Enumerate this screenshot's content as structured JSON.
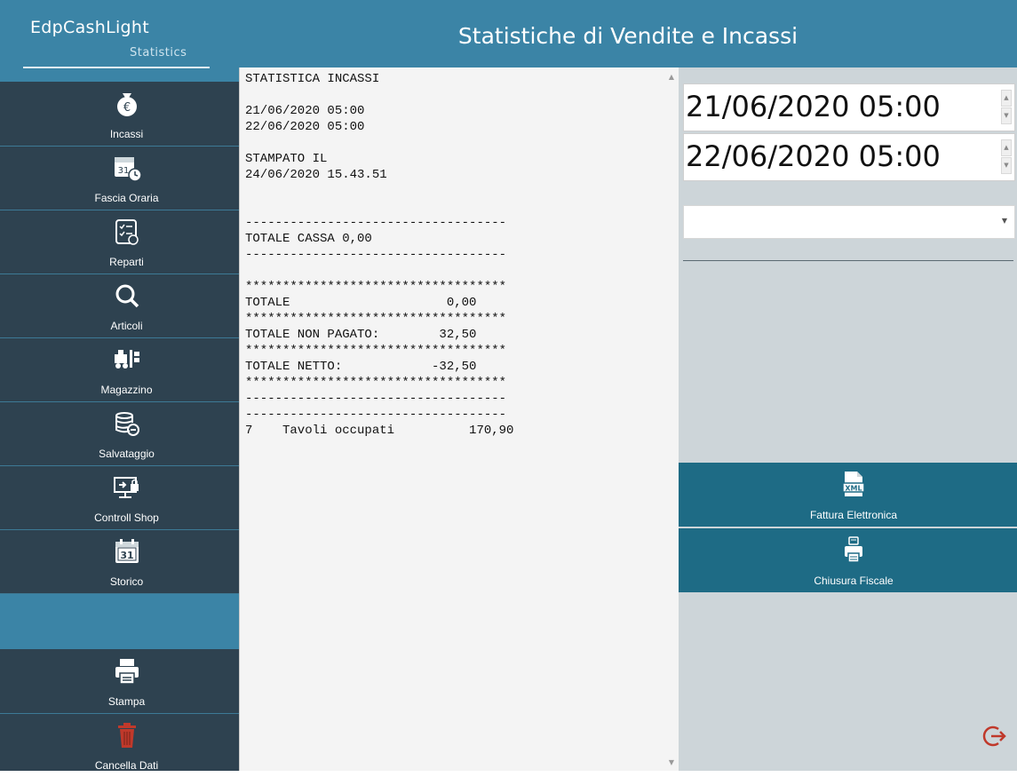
{
  "app": {
    "name": "EdpCashLight",
    "subtitle": "Statistics",
    "window_title": "Statistiche di Vendite e Incassi"
  },
  "sidebar": {
    "items": [
      {
        "label": "Incassi",
        "icon": "euro-bag-icon"
      },
      {
        "label": "Fascia Oraria",
        "icon": "calendar-clock-icon"
      },
      {
        "label": "Reparti",
        "icon": "checklist-icon"
      },
      {
        "label": "Articoli",
        "icon": "search-icon"
      },
      {
        "label": "Magazzino",
        "icon": "forklift-warehouse-icon"
      },
      {
        "label": "Salvataggio",
        "icon": "database-save-icon"
      },
      {
        "label": "Controll Shop",
        "icon": "monitor-lock-icon"
      },
      {
        "label": "Storico",
        "icon": "calendar-31-icon"
      }
    ],
    "bottom": [
      {
        "label": "Stampa",
        "icon": "printer-icon"
      },
      {
        "label": "Cancella Dati",
        "icon": "trash-icon"
      }
    ]
  },
  "report": {
    "text": "STATISTICA INCASSI\n\n21/06/2020 05:00\n22/06/2020 05:00\n\nSTAMPATO IL\n24/06/2020 15.43.51\n\n\n-----------------------------------\nTOTALE CASSA 0,00\n-----------------------------------\n\n***********************************\nTOTALE                     0,00\n***********************************\nTOTALE NON PAGATO:        32,50\n***********************************\nTOTALE NETTO:            -32,50\n***********************************\n-----------------------------------\n-----------------------------------\n7    Tavoli occupati          170,90"
  },
  "filters": {
    "date_from": "21/06/2020 05:00",
    "date_to": "22/06/2020 05:00",
    "dropdown_value": ""
  },
  "actions": [
    {
      "label": "Fattura Elettronica",
      "icon": "xml-file-icon"
    },
    {
      "label": "Chiusura Fiscale",
      "icon": "fiscal-printer-icon"
    }
  ],
  "colors": {
    "header": "#3b84a6",
    "sidebar": "#2e4250",
    "action_button": "#1e6b85",
    "right_panel": "#cdd5d9",
    "exit_icon": "#c0392b",
    "trash_icon": "#c0392b"
  }
}
